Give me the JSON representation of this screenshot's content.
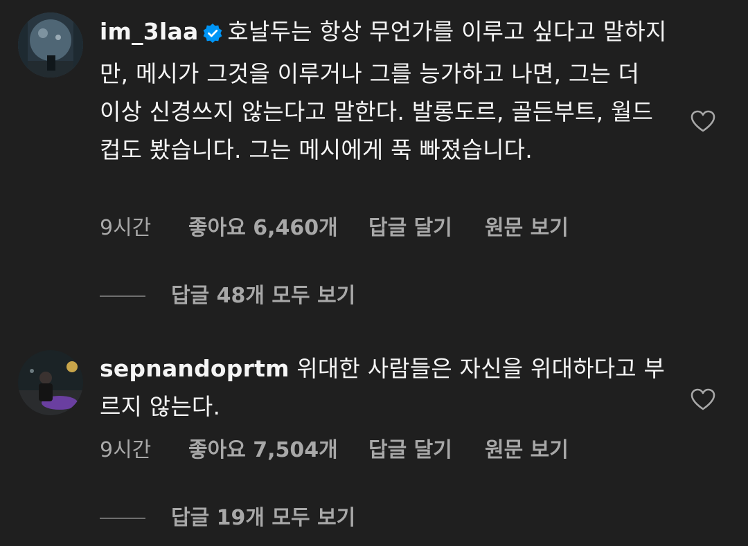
{
  "comments": [
    {
      "username": "im_3laa",
      "verified": true,
      "text": "호날두는 항상 무언가를 이루고 싶다고 말하지만, 메시가 그것을 이루거나 그를 능가하고 나면, 그는 더 이상 신경쓰지 않는다고 말한다. 발롱도르, 골든부트, 월드컵도 봤습니다. 그는 메시에게 푹 빠졌습니다.",
      "time": "9시간",
      "likes": "좋아요 6,460개",
      "reply_action": "답글 달기",
      "translate_action": "원문 보기",
      "view_replies": "답글 48개 모두 보기",
      "like_icon": "heart-outline-icon"
    },
    {
      "username": "sepnandoprtm",
      "verified": false,
      "text": "위대한 사람들은 자신을 위대하다고 부르지 않는다.",
      "time": "9시간",
      "likes": "좋아요 7,504개",
      "reply_action": "답글 달기",
      "translate_action": "원문 보기",
      "view_replies": "답글 19개 모두 보기",
      "like_icon": "heart-outline-icon"
    }
  ],
  "colors": {
    "background": "#1f1f1f",
    "primary_text": "#f5f5f5",
    "secondary_text": "#a8a8a8",
    "verified_badge": "#0095f6"
  }
}
